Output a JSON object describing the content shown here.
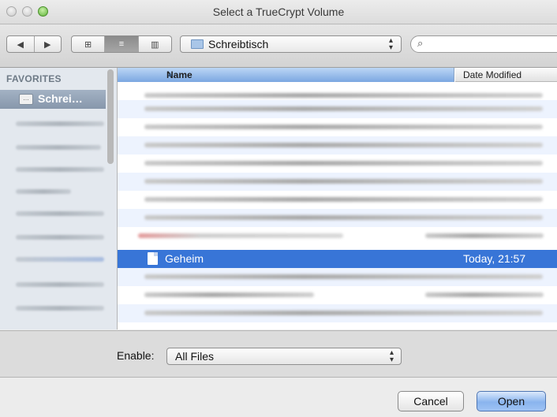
{
  "window": {
    "title": "Select a TrueCrypt Volume"
  },
  "toolbar": {
    "back_glyph": "◀",
    "forward_glyph": "▶",
    "view_icons_glyph": "⊞",
    "view_list_glyph": "≡",
    "view_columns_glyph": "▥",
    "location": "Schreibtisch",
    "popup_arrows": "▴▾",
    "search_glyph": "⌕",
    "search_value": ""
  },
  "sidebar": {
    "heading": "FAVORITES",
    "selected_item": "Schrei…",
    "selected_item_icon": "…"
  },
  "filelist": {
    "header_name": "Name",
    "header_date": "Date Modified",
    "sort_glyph": "▲",
    "selected_file": {
      "name": "Geheim",
      "date": "Today, 21:57"
    }
  },
  "filter": {
    "label": "Enable:",
    "value": "All Files",
    "arrows": "▴▾"
  },
  "buttons": {
    "cancel": "Cancel",
    "open": "Open"
  }
}
